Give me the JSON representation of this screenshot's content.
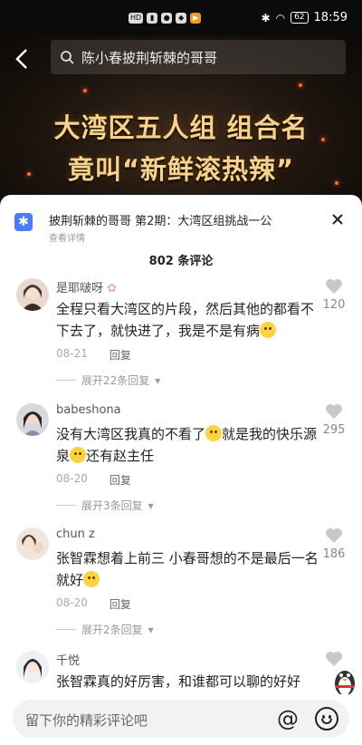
{
  "status_bar": {
    "left_icons": [
      "HD",
      "4G",
      "msg",
      "chat",
      "app"
    ],
    "battery": "62",
    "time": "18:59"
  },
  "header": {
    "search_text": "陈小春披荆斩棘的哥哥",
    "video_title_line1": "大湾区五人组 组合名",
    "video_title_line2": "竟叫“新鲜滚热辣”"
  },
  "sheet": {
    "episode_title": "披荆斩棘的哥哥 第2期：大湾区组挑战一公",
    "view_details": "查看详情",
    "comment_count": "802 条评论"
  },
  "comments": [
    {
      "username": "是耶啵呀",
      "text_parts": [
        "全程只看大湾区的片段，然后其他的都看不下去了，就快进了，我是不是有病"
      ],
      "date": "08-21",
      "reply": "回复",
      "expand": "展开22条回复",
      "likes": "120"
    },
    {
      "username": "babeshona",
      "text_parts": [
        "没有大湾区我真的不看了",
        "就是我的快乐源泉",
        "还有赵主任"
      ],
      "date": "08-20",
      "reply": "回复",
      "expand": "展开3条回复",
      "likes": "295"
    },
    {
      "username": "chun z",
      "text_parts": [
        "张智霖想着上前三 小春哥想的不是最后一名就好"
      ],
      "date": "08-20",
      "reply": "回复",
      "expand": "展开2条回复",
      "likes": "186"
    },
    {
      "username": "千悦",
      "text_parts": [
        "张智霖真的好厉害，和谁都可以聊的好好"
      ]
    }
  ],
  "input": {
    "placeholder": "留下你的精彩评论吧",
    "at_symbol": "@"
  },
  "colors": {
    "title_gold": "#f7d28a",
    "accent_blue": "#4a7cf7"
  }
}
